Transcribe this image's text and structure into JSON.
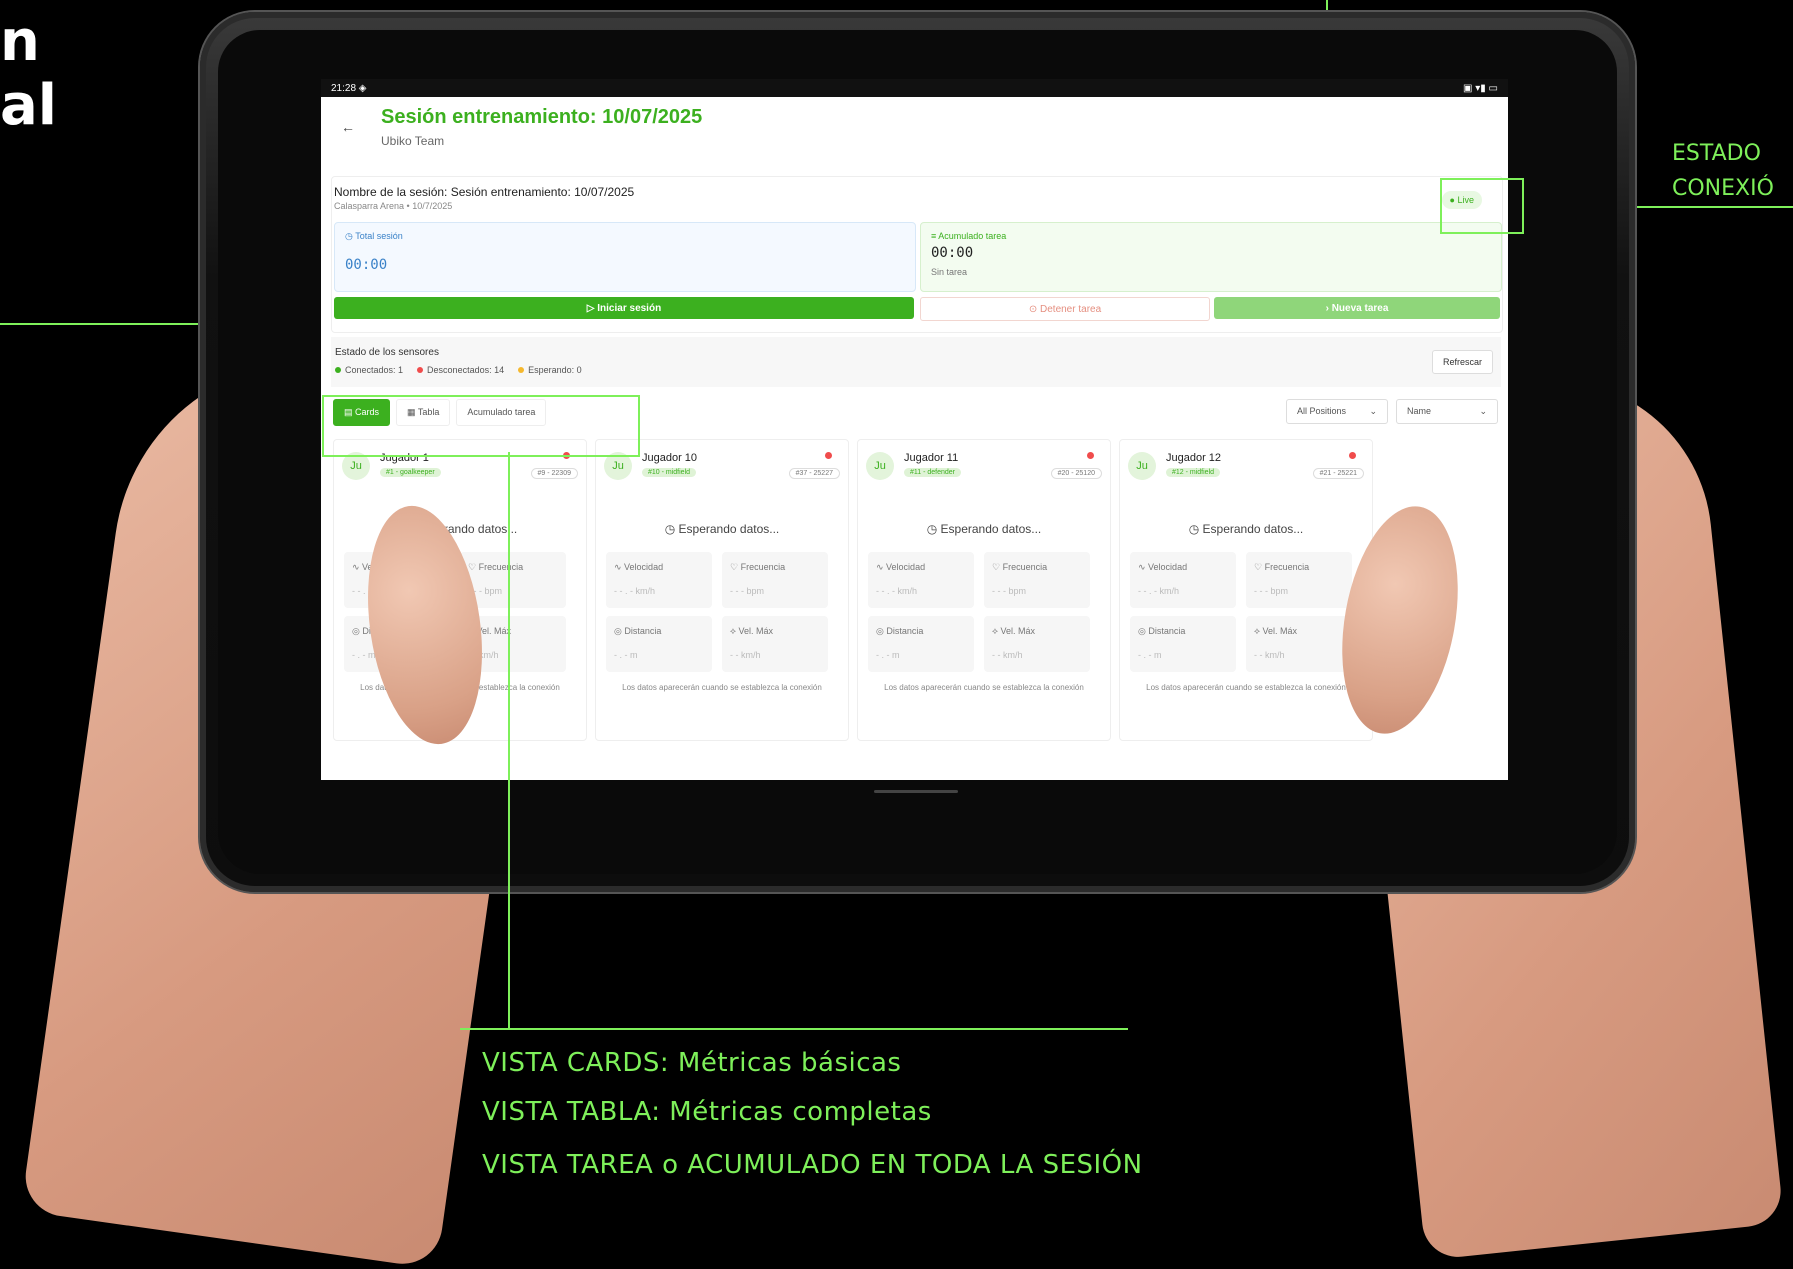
{
  "hero": {
    "line1": "n",
    "line2": "al"
  },
  "annotations": {
    "estado": "ESTADO",
    "conexion": "CONEXIÓ",
    "views_caption": [
      "VISTA CARDS: Métricas básicas",
      "VISTA TABLA: Métricas completas",
      "VISTA TAREA o ACUMULADO EN TODA LA SESIÓN"
    ]
  },
  "statusbar": {
    "time": "21:28 ◈",
    "icons": "▣ ▾▮ ▭"
  },
  "header": {
    "back": "←",
    "title": "Sesión entrenamiento: 10/07/2025",
    "subtitle": "Ubiko Team"
  },
  "session": {
    "name": "Nombre de la sesión: Sesión entrenamiento: 10/07/2025",
    "meta": "Calasparra Arena • 10/7/2025",
    "live_label": "● Live",
    "total_label": "◷ Total sesión",
    "total_value": "00:00",
    "accum_label": "≡ Acumulado tarea",
    "accum_value": "00:00",
    "accum_sub": "Sin tarea",
    "start_button": "▷   Iniciar sesión",
    "stop_button": "⊙   Detener tarea",
    "new_button": "›   Nueva tarea"
  },
  "sensors": {
    "title": "Estado de los sensores",
    "connected": "Conectados: 1",
    "disconnected": "Desconectados: 14",
    "waiting": "Esperando: 0",
    "refresh": "Refrescar"
  },
  "views": {
    "cards": "▤  Cards",
    "table": "▦  Tabla",
    "accum": "Acumulado tarea"
  },
  "filters": {
    "positions": "All Positions",
    "sort": "Name",
    "chevron": "⌄"
  },
  "cards": [
    {
      "initials": "Ju",
      "name": "Jugador 1",
      "position": "#1 - goalkeeper",
      "id": "#9 - 22309"
    },
    {
      "initials": "Ju",
      "name": "Jugador 10",
      "position": "#10 - midfield",
      "id": "#37 - 25227"
    },
    {
      "initials": "Ju",
      "name": "Jugador 11",
      "position": "#11 - defender",
      "id": "#20 - 25120"
    },
    {
      "initials": "Ju",
      "name": "Jugador 12",
      "position": "#12 - midfield",
      "id": "#21 - 25221"
    }
  ],
  "card_common": {
    "waiting": "◷  Esperando datos...",
    "speed_label": "∿ Velocidad",
    "speed_value": "- - . -  km/h",
    "freq_label": "♡ Frecuencia",
    "freq_value": "- - -  bpm",
    "dist_label": "◎ Distancia",
    "dist_value": "- . -  m",
    "maxspeed_label": "⟡ Vel. Máx",
    "maxspeed_value": "- -  km/h",
    "note": "Los datos aparecerán cuando se establezca la conexión"
  },
  "colors": {
    "accent": "#3cb01f",
    "annotation": "#7ef05a",
    "disconnected": "#f04c4c",
    "waiting": "#f5b82e"
  }
}
